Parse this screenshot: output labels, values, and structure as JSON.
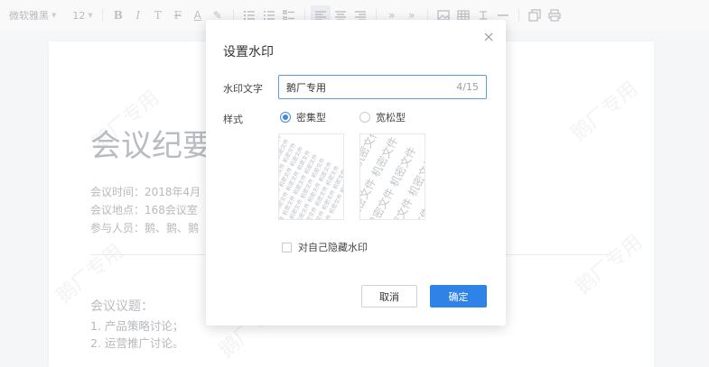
{
  "toolbar": {
    "font_family": "微软雅黑",
    "font_size": "12",
    "icons": [
      "bold-icon",
      "italic-icon",
      "text-style-icon",
      "strikethrough-icon",
      "font-color-icon",
      "highlight-icon",
      "ordered-list-icon",
      "bullet-list-icon",
      "checklist-icon",
      "align-left-icon",
      "align-center-icon",
      "align-right-icon",
      "indent-decrease-icon",
      "indent-increase-icon",
      "image-icon",
      "table-icon",
      "divider-icon",
      "horizontal-line-icon",
      "copy-format-icon",
      "print-icon"
    ]
  },
  "document": {
    "title": "会议纪要",
    "meta": [
      "会议时间：2018年4月",
      "会议地点：168会议室",
      "参与人员：鹅、鹅、鹅"
    ],
    "topics_title": "会议议题：",
    "topics": [
      "1. 产品策略讨论；",
      "2. 运营推广讨论。"
    ],
    "background_watermark": "鹅厂专用"
  },
  "dialog": {
    "title": "设置水印",
    "watermark_text_label": "水印文字",
    "watermark_text_value": "鹅厂专用",
    "char_counter": "4/15",
    "style_label": "样式",
    "style_options": [
      {
        "label": "密集型",
        "checked": true
      },
      {
        "label": "宽松型",
        "checked": false
      }
    ],
    "preview_text": "机密文件",
    "hide_for_self_label": "对自己隐藏水印",
    "hide_for_self_checked": false,
    "cancel_label": "取消",
    "ok_label": "确定",
    "accent_color": "#2f83e6"
  }
}
